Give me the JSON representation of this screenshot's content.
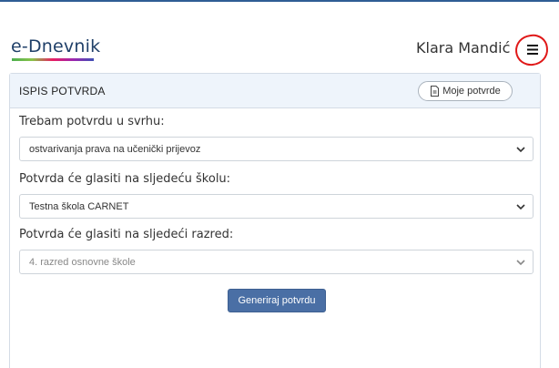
{
  "header": {
    "logo_text": "e-Dnevnik",
    "user_name": "Klara Mandić",
    "menu_icon": "hamburger-menu-icon"
  },
  "card": {
    "title": "ISPIS POTVRDA",
    "my_certificates_button": "Moje potvrde",
    "my_certificates_icon": "document-icon",
    "fields": [
      {
        "label": "Trebam potvrdu u svrhu:",
        "value": "ostvarivanja prava na učenički prijevoz",
        "disabled": false
      },
      {
        "label": "Potvrda će glasiti na sljedeću školu:",
        "value": "Testna škola CARNET",
        "disabled": false
      },
      {
        "label": "Potvrda će glasiti na sljedeći razred:",
        "value": "4. razred osnovne škole",
        "disabled": true
      }
    ],
    "generate_button": "Generiraj potvrdu"
  },
  "colors": {
    "header_bg": "#eef4fb",
    "primary_button": "#4a6fa5",
    "annotation_circle": "#e01818",
    "logo": "#1f3f68"
  }
}
